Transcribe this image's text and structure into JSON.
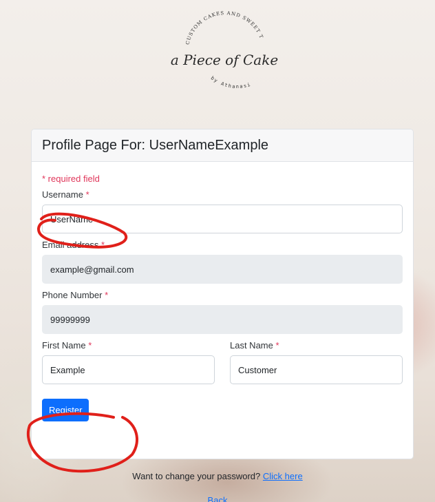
{
  "logo": {
    "arc_text": "CUSTOM CAKES AND SWEET TREATS",
    "wordmark": "a Piece of Cake",
    "byline": "by Athanasia"
  },
  "card": {
    "title": "Profile Page For: UserNameExample",
    "required_note": "* required field"
  },
  "form": {
    "username": {
      "label": "Username",
      "value": "UserName"
    },
    "email": {
      "label": "Email address",
      "value": "example@gmail.com"
    },
    "phone": {
      "label": "Phone Number",
      "value": "99999999"
    },
    "first_name": {
      "label": "First Name",
      "value": "Example"
    },
    "last_name": {
      "label": "Last Name",
      "value": "Customer"
    },
    "required_marker": "*",
    "submit_label": "Register"
  },
  "footer": {
    "password_text": "Want to change your password?",
    "password_link": "Click here",
    "back_link": "Back"
  },
  "colors": {
    "primary": "#0d6efd",
    "required": "#e0365a",
    "annotation": "#e0201a"
  }
}
